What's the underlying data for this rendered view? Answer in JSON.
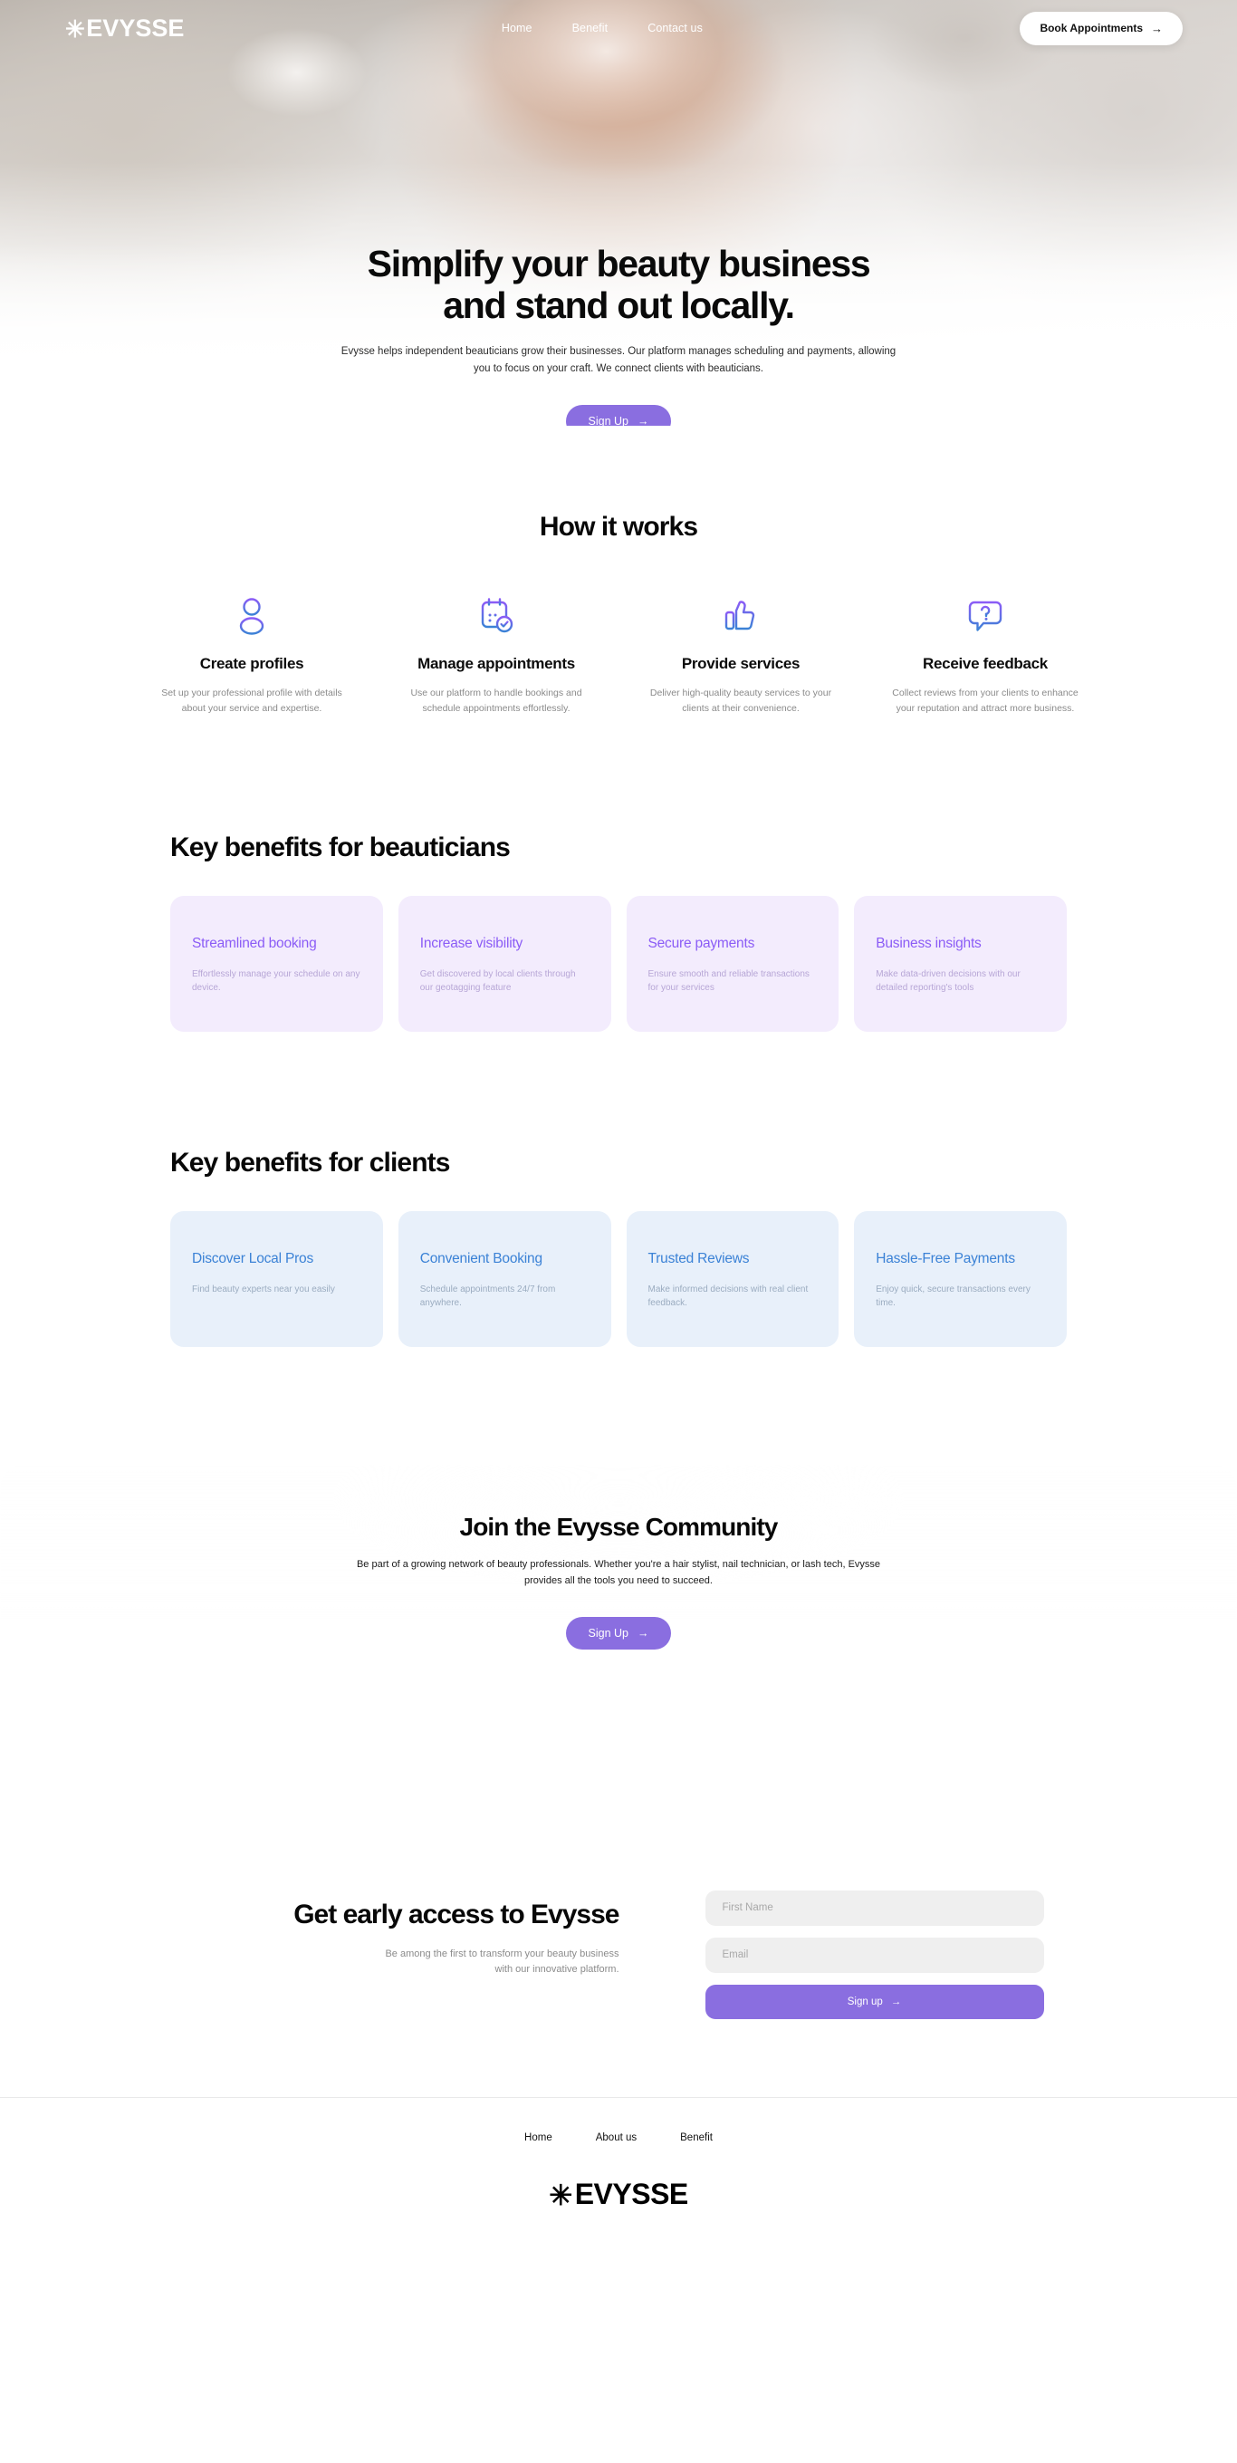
{
  "brand": {
    "logo_star": "✳",
    "logo_text": "EVYSSE"
  },
  "nav": {
    "links": [
      {
        "label": "Home"
      },
      {
        "label": "Benefit"
      },
      {
        "label": "Contact us"
      }
    ],
    "cta": {
      "label": "Book Appointments",
      "arrow": "→"
    }
  },
  "hero": {
    "title_line1": "Simplify your beauty business",
    "title_line2": "and stand out locally.",
    "subtitle": "Evysse helps independent beauticians grow their businesses. Our platform manages scheduling and payments, allowing you to focus on your craft. We connect clients with beauticians.",
    "cta": {
      "label": "Sign Up",
      "arrow": "→"
    }
  },
  "how_it_works": {
    "heading": "How it works",
    "items": [
      {
        "icon": "user-profile-icon",
        "title": "Create profiles",
        "desc": "Set up your professional profile with details about your service and expertise."
      },
      {
        "icon": "calendar-check-icon",
        "title": "Manage appointments",
        "desc": "Use our platform to handle bookings and schedule appointments effortlessly."
      },
      {
        "icon": "thumbs-up-icon",
        "title": "Provide services",
        "desc": "Deliver high-quality beauty services to your clients at their convenience."
      },
      {
        "icon": "question-bubble-icon",
        "title": "Receive feedback",
        "desc": "Collect reviews from your clients to enhance your reputation and attract more business."
      }
    ]
  },
  "benefits_beauticians": {
    "heading": "Key benefits for beauticians",
    "accent": "#8b5cf6",
    "card_bg": "#f3ecfd",
    "cards": [
      {
        "title": "Streamlined booking",
        "desc": "Effortlessly manage your schedule on any device."
      },
      {
        "title": "Increase visibility",
        "desc": "Get discovered by local clients through our geotagging feature"
      },
      {
        "title": "Secure payments",
        "desc": "Ensure smooth and reliable transactions for your services"
      },
      {
        "title": "Business insights",
        "desc": "Make data-driven decisions with our detailed reporting's tools"
      }
    ]
  },
  "benefits_clients": {
    "heading": "Key benefits for clients",
    "accent": "#3b82d6",
    "card_bg": "#e8f0fa",
    "cards": [
      {
        "title": "Discover Local Pros",
        "desc": "Find beauty experts near you easily"
      },
      {
        "title": "Convenient Booking",
        "desc": "Schedule appointments 24/7 from anywhere."
      },
      {
        "title": "Trusted Reviews",
        "desc": "Make informed decisions with real client feedback."
      },
      {
        "title": "Hassle-Free Payments",
        "desc": "Enjoy quick, secure transactions every time."
      }
    ]
  },
  "community": {
    "title": "Join the Evysse Community",
    "subtitle": "Be part of a growing network of beauty professionals. Whether you're a hair stylist, nail technician, or lash tech, Evysse provides all the tools you need to succeed.",
    "cta": {
      "label": "Sign Up",
      "arrow": "→"
    }
  },
  "early_access": {
    "title": "Get early access to Evysse",
    "subtitle": "Be among the first to transform your beauty business with our innovative platform.",
    "first_name_placeholder": "First Name",
    "first_name_value": "",
    "email_placeholder": "Email",
    "email_value": "",
    "submit": {
      "label": "Sign up",
      "arrow": "→"
    }
  },
  "footer": {
    "links": [
      {
        "label": "Home"
      },
      {
        "label": "About us"
      },
      {
        "label": "Benefit"
      }
    ]
  },
  "colors": {
    "purple": "#8a6ee0",
    "purple_accent": "#8b5cf6",
    "blue_accent": "#3b82d6",
    "purple_card": "#f3ecfd",
    "blue_card": "#e8f0fa",
    "field_bg": "#efefef"
  }
}
